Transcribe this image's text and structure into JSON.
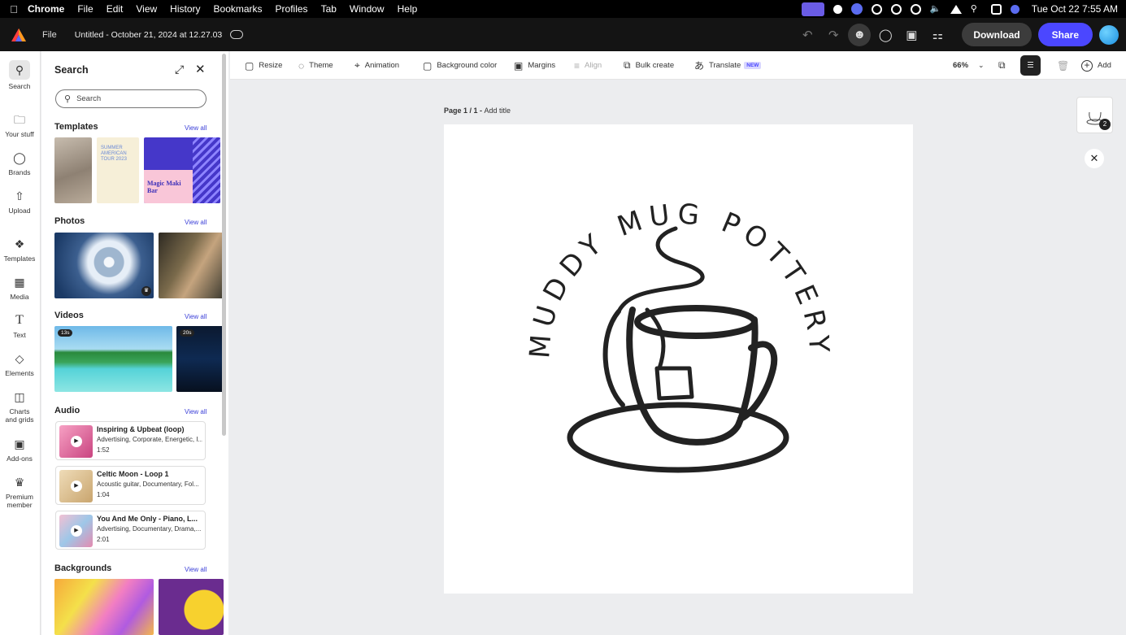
{
  "menubar": {
    "items": [
      "Chrome",
      "File",
      "Edit",
      "View",
      "History",
      "Bookmarks",
      "Profiles",
      "Tab",
      "Window",
      "Help"
    ],
    "clock": "Tue Oct 22  7:55 AM"
  },
  "header": {
    "file_label": "File",
    "doc_title": "Untitled - October 21, 2024 at 12.27.03",
    "download_label": "Download",
    "share_label": "Share"
  },
  "rail": {
    "items": [
      {
        "label": "Search",
        "icon": "search-icon"
      },
      {
        "label": "Your stuff",
        "icon": "folder-icon"
      },
      {
        "label": "Brands",
        "icon": "brand-icon"
      },
      {
        "label": "Upload",
        "icon": "upload-icon"
      },
      {
        "label": "Templates",
        "icon": "templates-icon"
      },
      {
        "label": "Media",
        "icon": "media-icon"
      },
      {
        "label": "Text",
        "icon": "text-icon"
      },
      {
        "label": "Elements",
        "icon": "elements-icon"
      },
      {
        "label": "Charts and grids",
        "icon": "charts-icon"
      },
      {
        "label": "Add-ons",
        "icon": "addons-icon"
      },
      {
        "label": "Premium member",
        "icon": "crown-icon"
      }
    ]
  },
  "panel": {
    "title": "Search",
    "search_placeholder": "Search",
    "view_all": "View all",
    "sections": {
      "templates": "Templates",
      "photos": "Photos",
      "videos": "Videos",
      "audio": "Audio",
      "backgrounds": "Backgrounds"
    },
    "template_texts": {
      "summer": "SUMMER AMERICAN TOUR 2023",
      "magic": "Magic Maki Bar"
    },
    "videos": [
      {
        "duration": "13s"
      },
      {
        "duration": "20s"
      }
    ],
    "audio": [
      {
        "title": "Inspiring & Upbeat (loop)",
        "desc": "Advertising, Corporate, Energetic, I...",
        "length": "1:52"
      },
      {
        "title": "Celtic Moon - Loop 1",
        "desc": "Acoustic guitar, Documentary, Fol...",
        "length": "1:04"
      },
      {
        "title": "You And Me Only - Piano, L...",
        "desc": "Advertising, Documentary, Drama,...",
        "length": "2:01"
      }
    ]
  },
  "toolbar": {
    "resize": "Resize",
    "theme": "Theme",
    "animation": "Animation",
    "background_color": "Background color",
    "margins": "Margins",
    "align": "Align",
    "bulk_create": "Bulk create",
    "translate": "Translate",
    "translate_badge": "NEW",
    "zoom": "66%",
    "add": "Add"
  },
  "canvas": {
    "page_label": "Page 1 / 1 - ",
    "add_title": "Add title",
    "logo_text": "MUDDY MUG POTTERY",
    "page_count": "2"
  }
}
